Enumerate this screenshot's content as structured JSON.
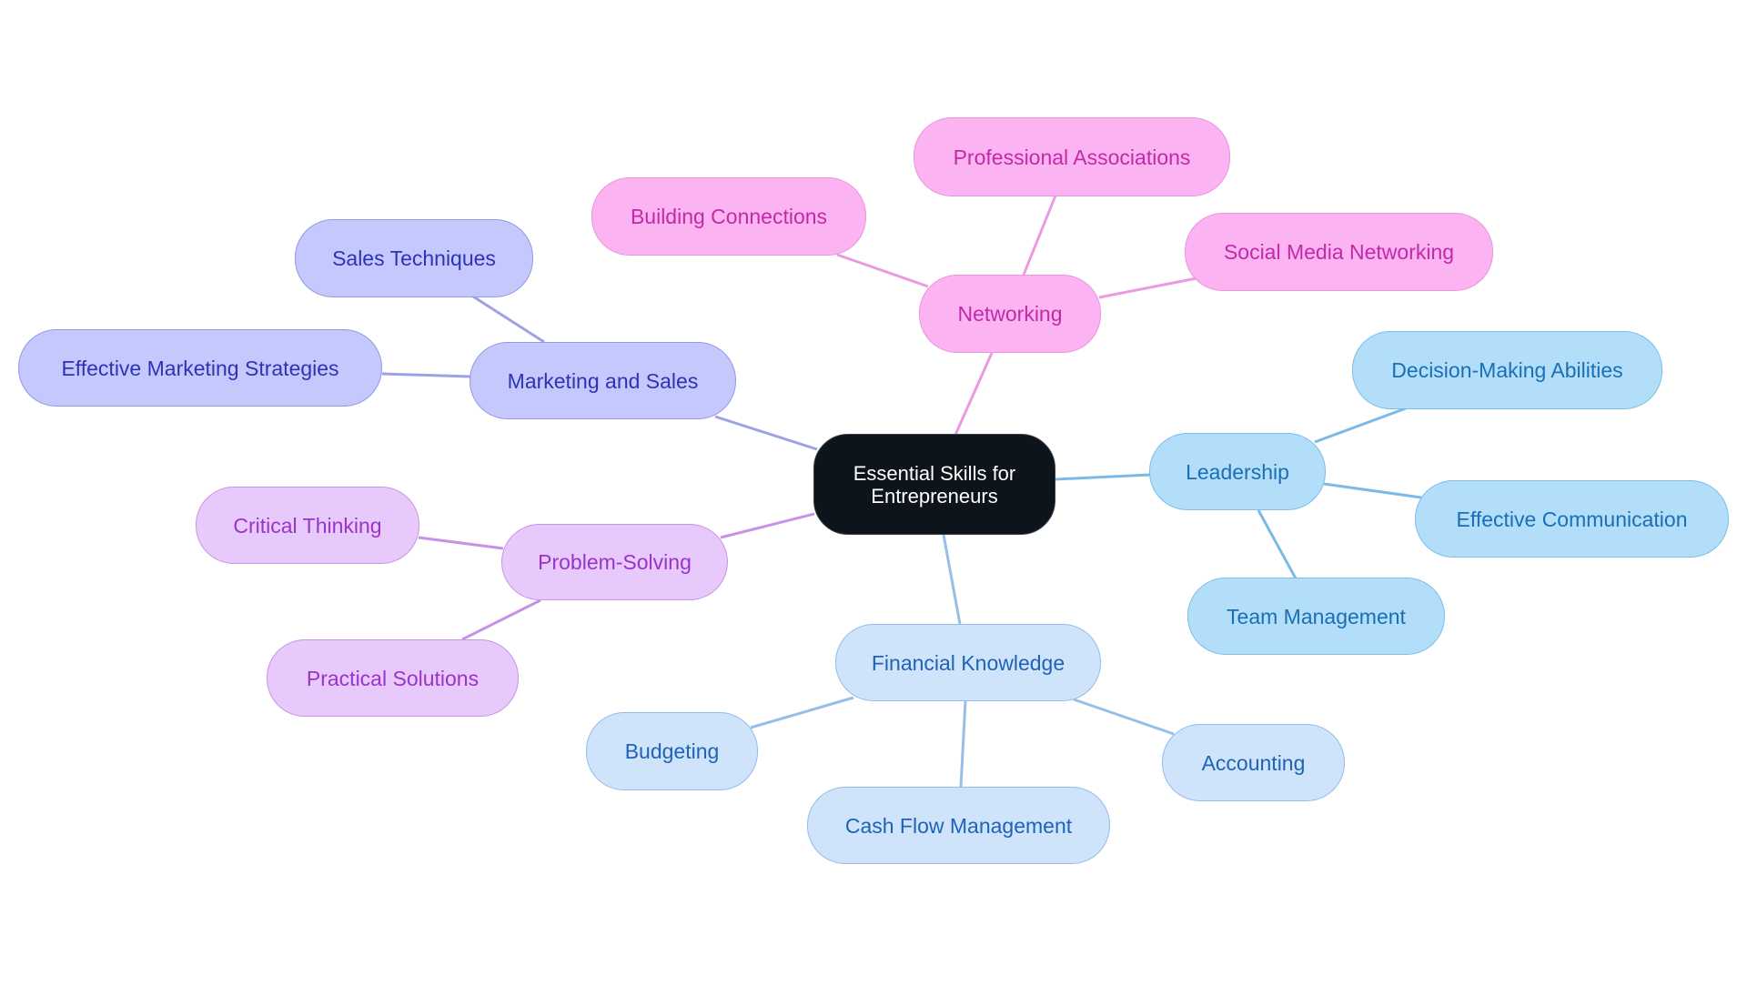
{
  "title": "Essential Skills for Entrepreneurs",
  "root": {
    "id": "root",
    "label": "Essential Skills for Entrepreneurs",
    "fill": "#0d141b",
    "text_color": "#ffffff"
  },
  "branches": [
    {
      "id": "networking",
      "label": "Networking",
      "colors": {
        "fill": "#fcb3f2",
        "stroke": "#e895dd",
        "text": "#c12aa8",
        "edge": "#e99ae0"
      },
      "children": [
        {
          "id": "building-connections",
          "label": "Building Connections"
        },
        {
          "id": "professional-associations",
          "label": "Professional Associations"
        },
        {
          "id": "social-media-networking",
          "label": "Social Media Networking"
        }
      ]
    },
    {
      "id": "leadership",
      "label": "Leadership",
      "colors": {
        "fill": "#b3defa",
        "stroke": "#7dbde8",
        "text": "#1a6fb5",
        "edge": "#79bbe6"
      },
      "children": [
        {
          "id": "decision-making-abilities",
          "label": "Decision-Making Abilities"
        },
        {
          "id": "effective-communication",
          "label": "Effective Communication"
        },
        {
          "id": "team-management",
          "label": "Team Management"
        }
      ]
    },
    {
      "id": "financial-knowledge",
      "label": "Financial Knowledge",
      "colors": {
        "fill": "#cfe3fb",
        "stroke": "#93bde8",
        "text": "#1d63b8",
        "edge": "#96bee6"
      },
      "children": [
        {
          "id": "budgeting",
          "label": "Budgeting"
        },
        {
          "id": "cash-flow-management",
          "label": "Cash Flow Management"
        },
        {
          "id": "accounting",
          "label": "Accounting"
        }
      ]
    },
    {
      "id": "problem-solving",
      "label": "Problem-Solving",
      "colors": {
        "fill": "#e8c9fb",
        "stroke": "#c795e6",
        "text": "#9a33c9",
        "edge": "#c792e6"
      },
      "children": [
        {
          "id": "critical-thinking",
          "label": "Critical Thinking"
        },
        {
          "id": "practical-solutions",
          "label": "Practical Solutions"
        }
      ]
    },
    {
      "id": "marketing-and-sales",
      "label": "Marketing and Sales",
      "colors": {
        "fill": "#c5c8fd",
        "stroke": "#9399e3",
        "text": "#2e33b5",
        "edge": "#9da2e6"
      },
      "children": [
        {
          "id": "sales-techniques",
          "label": "Sales Techniques"
        },
        {
          "id": "effective-marketing-strategies",
          "label": "Effective Marketing Strategies"
        }
      ]
    }
  ]
}
